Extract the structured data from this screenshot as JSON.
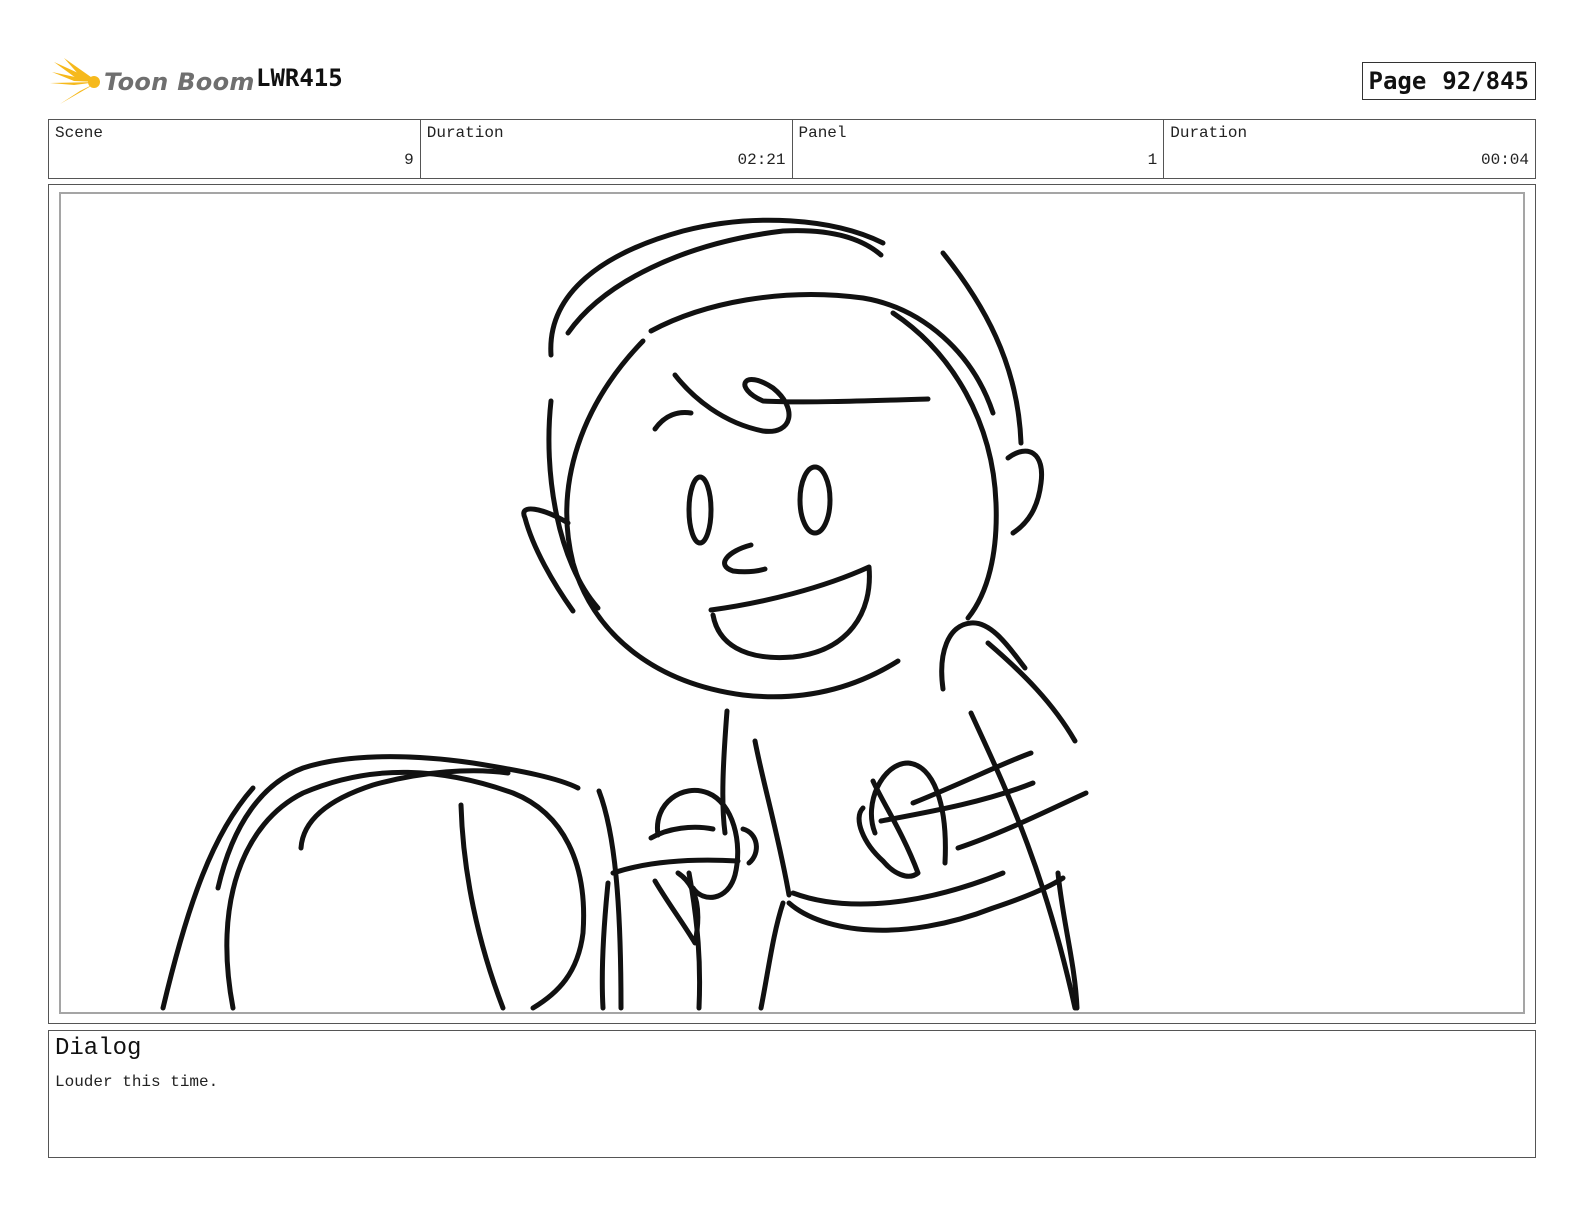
{
  "header": {
    "brand": "Toon Boom",
    "brand_accent_color": "#f6b91c",
    "logo_icon": "starburst-logo-icon",
    "project": "LWR415",
    "page_label": "Page",
    "page_value": "92/845"
  },
  "info": [
    {
      "label": "Scene",
      "value": "9"
    },
    {
      "label": "Duration",
      "value": "02:21"
    },
    {
      "label": "Panel",
      "value": "1"
    },
    {
      "label": "Duration",
      "value": "00:04"
    }
  ],
  "panel": {
    "content": "storyboard-sketch"
  },
  "dialog": {
    "title": "Dialog",
    "text": "Louder this time."
  }
}
